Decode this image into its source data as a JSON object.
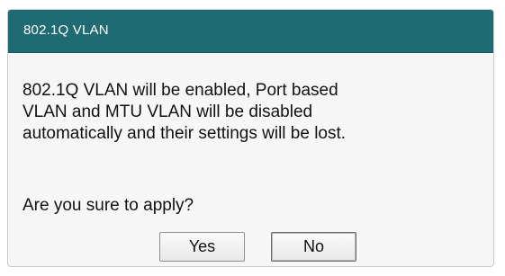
{
  "dialog": {
    "title": "802.1Q VLAN",
    "message_lines": [
      "802.1Q VLAN will be enabled, Port based",
      "VLAN and MTU VLAN will be disabled",
      "automatically and their settings will be lost."
    ],
    "question": "Are you sure to apply?",
    "buttons": {
      "yes_label": "Yes",
      "no_label": "No"
    }
  },
  "colors": {
    "titlebar": "#1f6b73",
    "dialog_background": "#f7f7f7"
  }
}
